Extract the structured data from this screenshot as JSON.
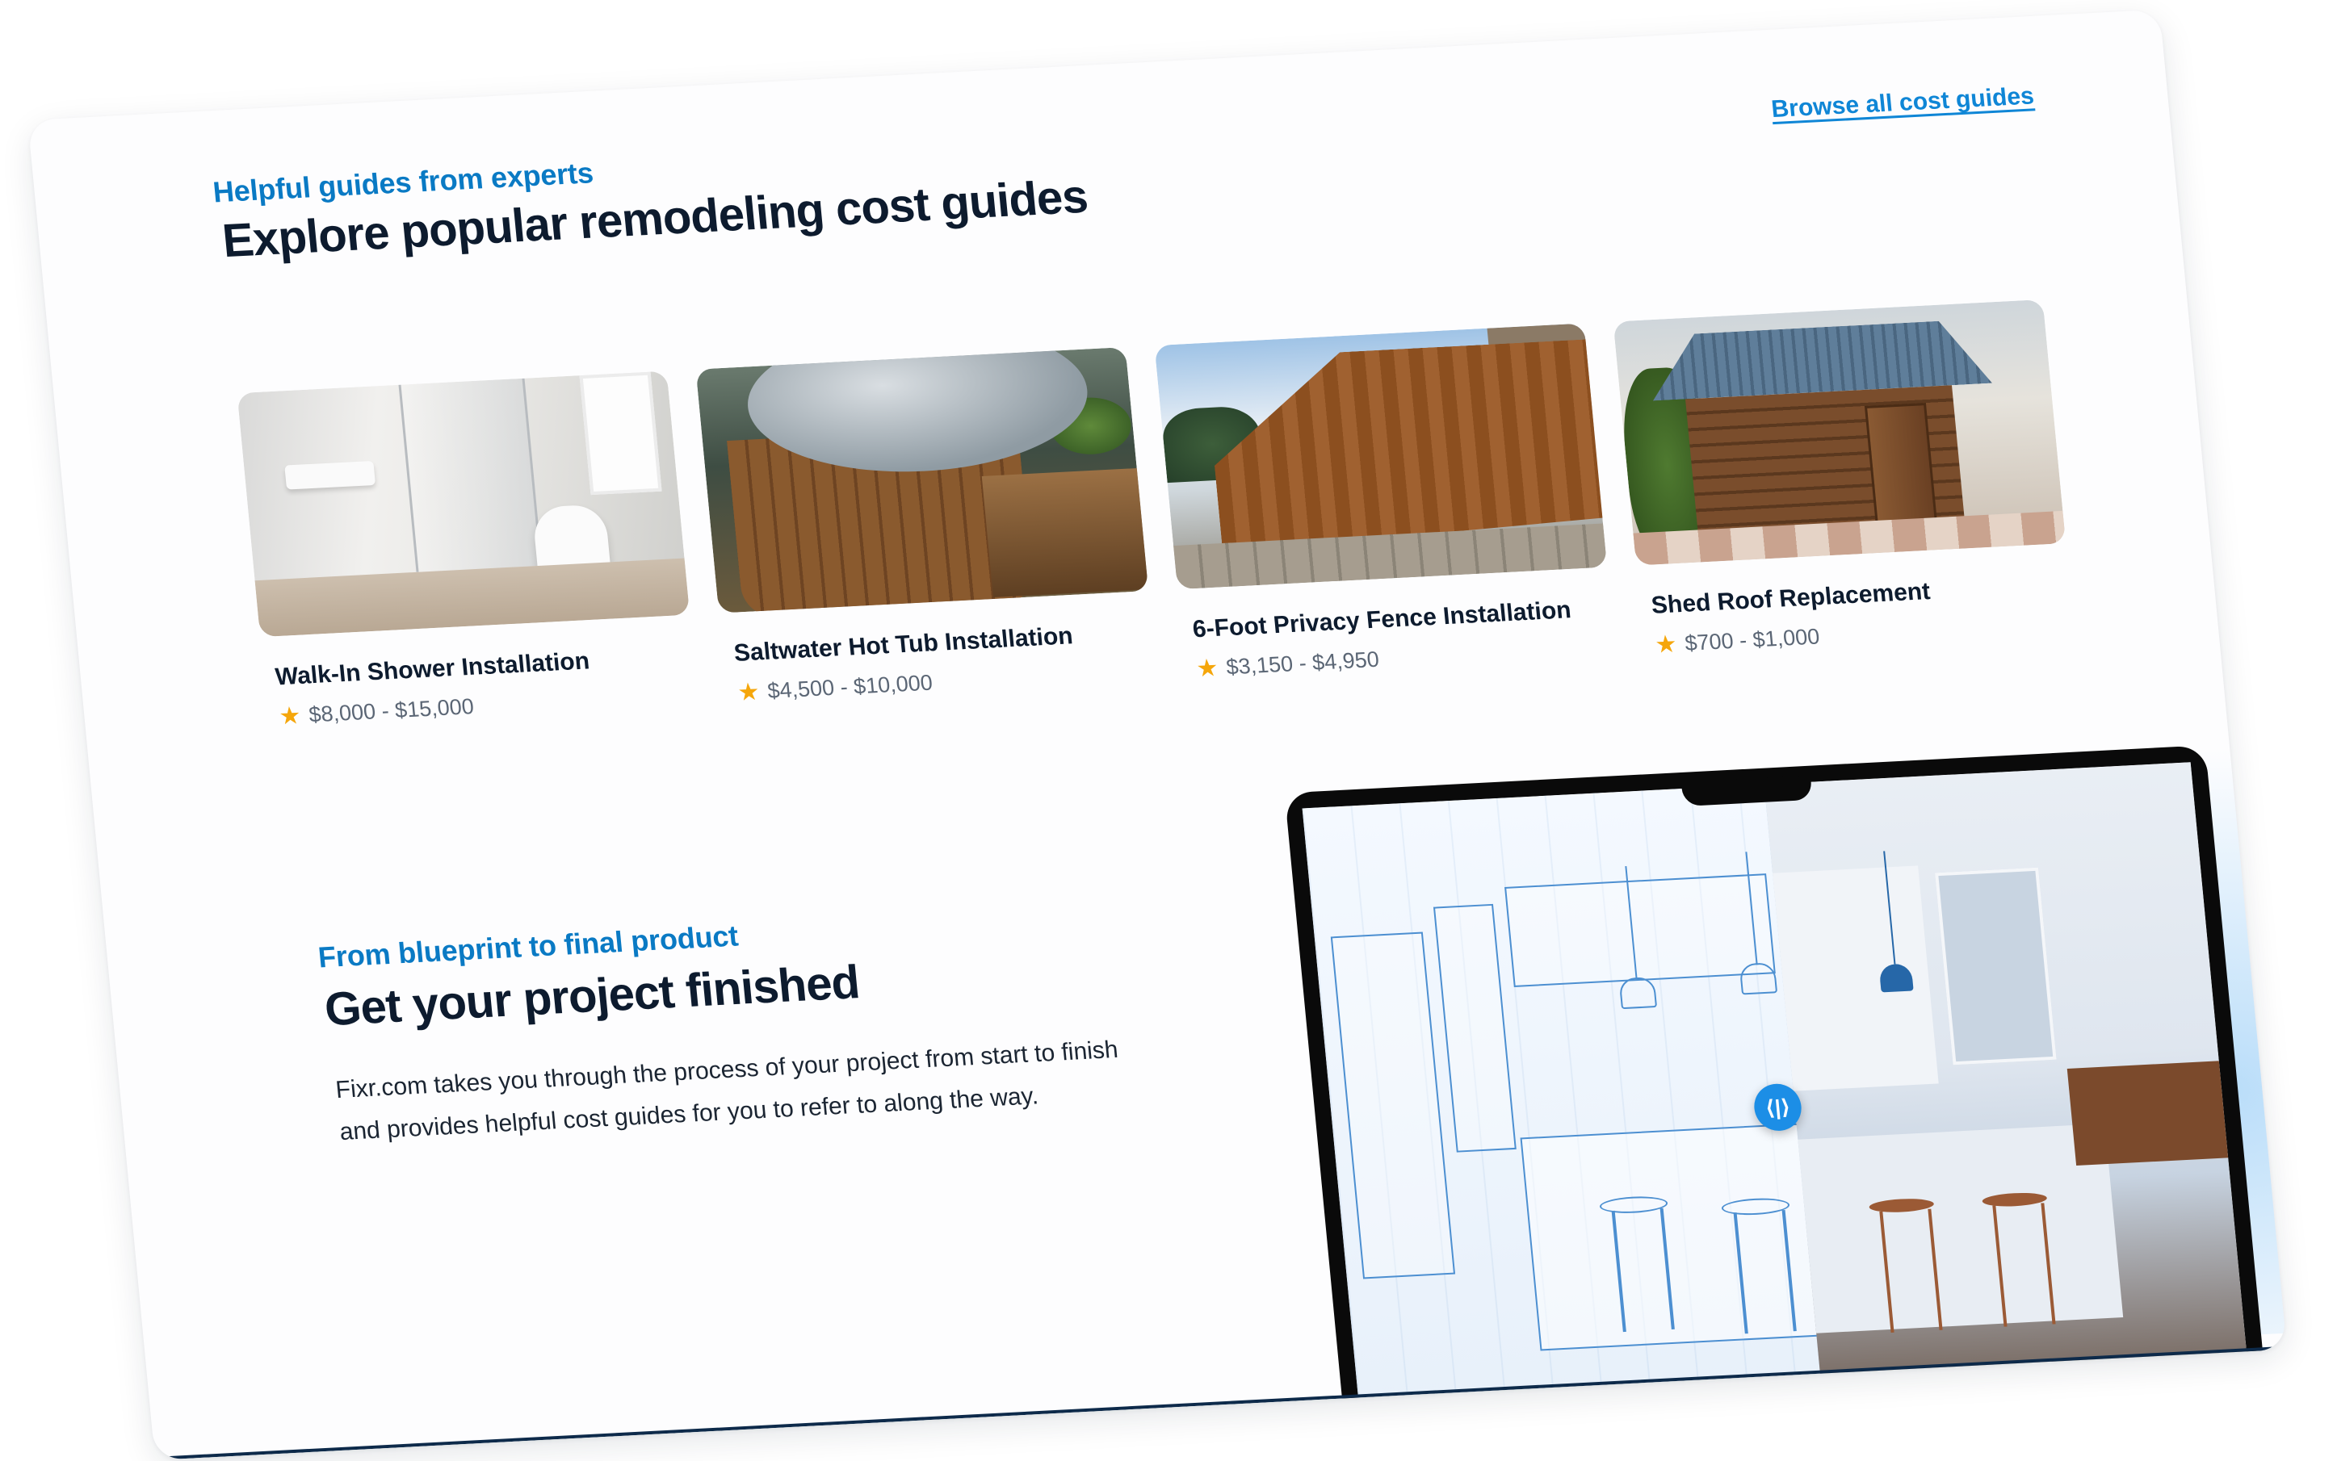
{
  "guides_section": {
    "eyebrow": "Helpful guides from experts",
    "title": "Explore popular remodeling cost guides",
    "browse_link": "Browse all cost guides",
    "cards": [
      {
        "title": "Walk-In Shower Installation",
        "price": "$8,000 - $15,000",
        "image": "walk-in-shower"
      },
      {
        "title": "Saltwater Hot Tub Installation",
        "price": "$4,500 - $10,000",
        "image": "hot-tub"
      },
      {
        "title": "6-Foot Privacy Fence Installation",
        "price": "$3,150 - $4,950",
        "image": "privacy-fence"
      },
      {
        "title": "Shed Roof Replacement",
        "price": "$700 - $1,000",
        "image": "shed"
      }
    ],
    "rating_icon": "star-icon"
  },
  "finish_section": {
    "eyebrow": "From blueprint to final product",
    "title": "Get your project finished",
    "body": "Fixr.com takes you through the process of your project from start to finish and provides helpful cost guides for you to refer to along the way.",
    "slider_icon": "compare-slider-icon"
  },
  "colors": {
    "accent": "#0a7ac4",
    "heading": "#0d1b2e",
    "star": "#f5a60b",
    "slider": "#1c8ee6"
  }
}
